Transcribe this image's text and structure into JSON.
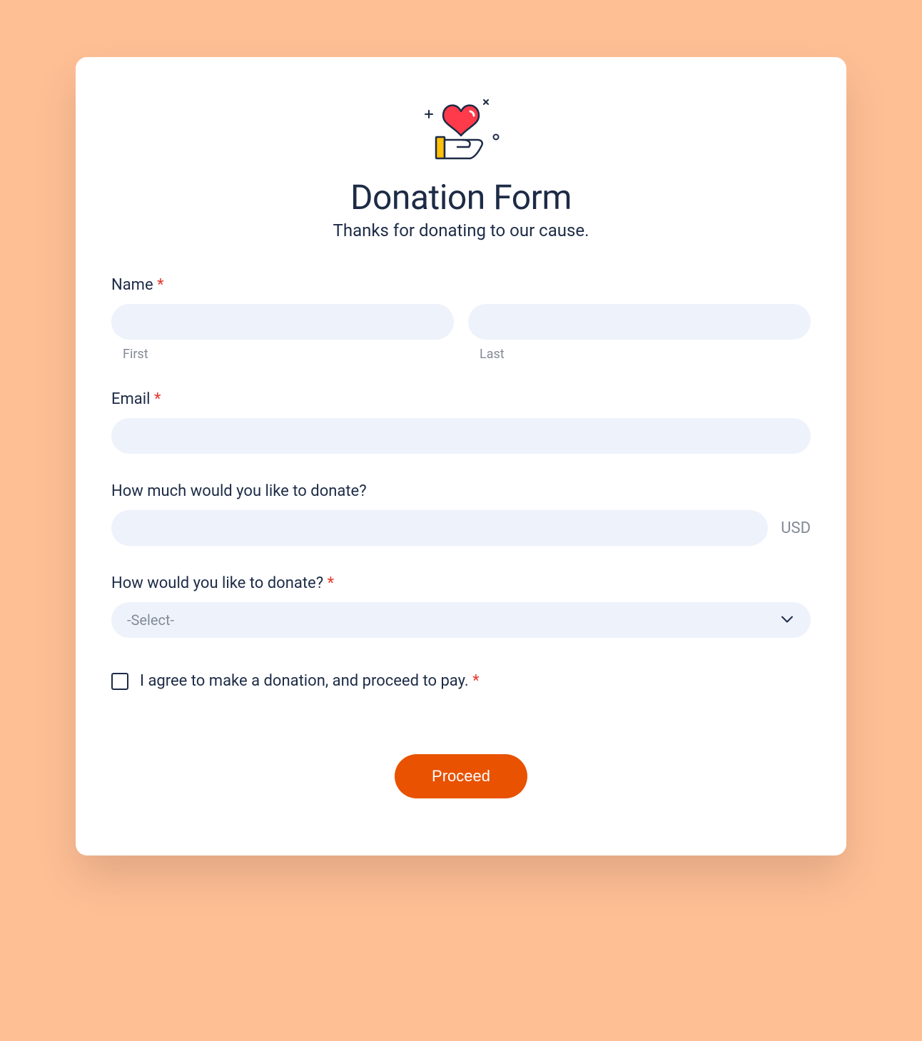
{
  "header": {
    "title": "Donation Form",
    "subtitle": "Thanks for donating to our cause."
  },
  "name": {
    "label": "Name",
    "first_sublabel": "First",
    "last_sublabel": "Last"
  },
  "email": {
    "label": "Email"
  },
  "amount": {
    "label": "How much would you like to donate?",
    "currency": "USD"
  },
  "method": {
    "label": "How would you like to donate?",
    "selected": "-Select-"
  },
  "agree": {
    "label": "I agree to make a donation, and proceed to pay."
  },
  "submit": {
    "label": "Proceed"
  },
  "required_mark": "*"
}
